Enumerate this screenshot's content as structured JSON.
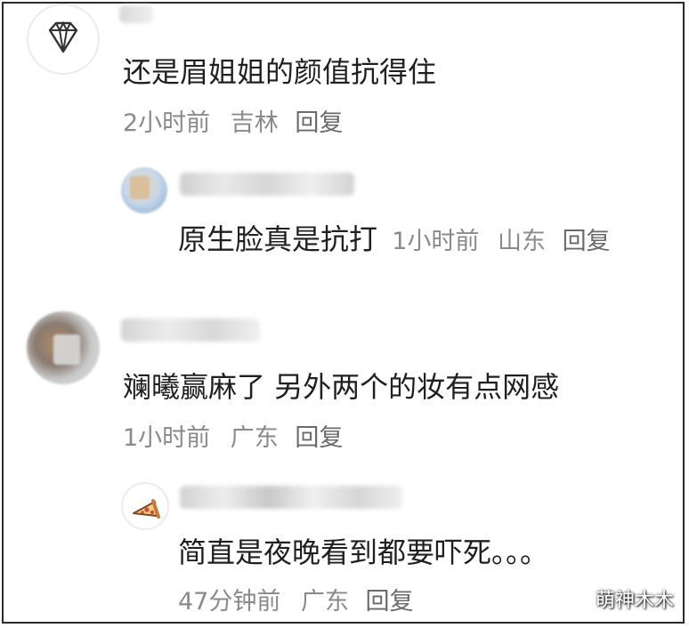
{
  "comments": [
    {
      "text": "还是眉姐姐的颜值抗得住",
      "time": "2小时前",
      "location": "吉林",
      "reply_label": "回复",
      "avatar_icon": "diamond-icon",
      "reply": {
        "text": "原生脸真是抗打",
        "time": "1小时前",
        "location": "山东",
        "reply_label": "回复",
        "avatar_icon": "blurred-photo"
      }
    },
    {
      "text": "斓曦赢麻了 另外两个的妆有点网感",
      "time": "1小时前",
      "location": "广东",
      "reply_label": "回复",
      "avatar_icon": "blurred-photo",
      "reply": {
        "text": "简直是夜晚看到都要吓死。。。",
        "time": "47分钟前",
        "location": "广东",
        "reply_label": "回复",
        "avatar_icon": "pizza-icon"
      }
    }
  ],
  "watermark": "萌神木木"
}
